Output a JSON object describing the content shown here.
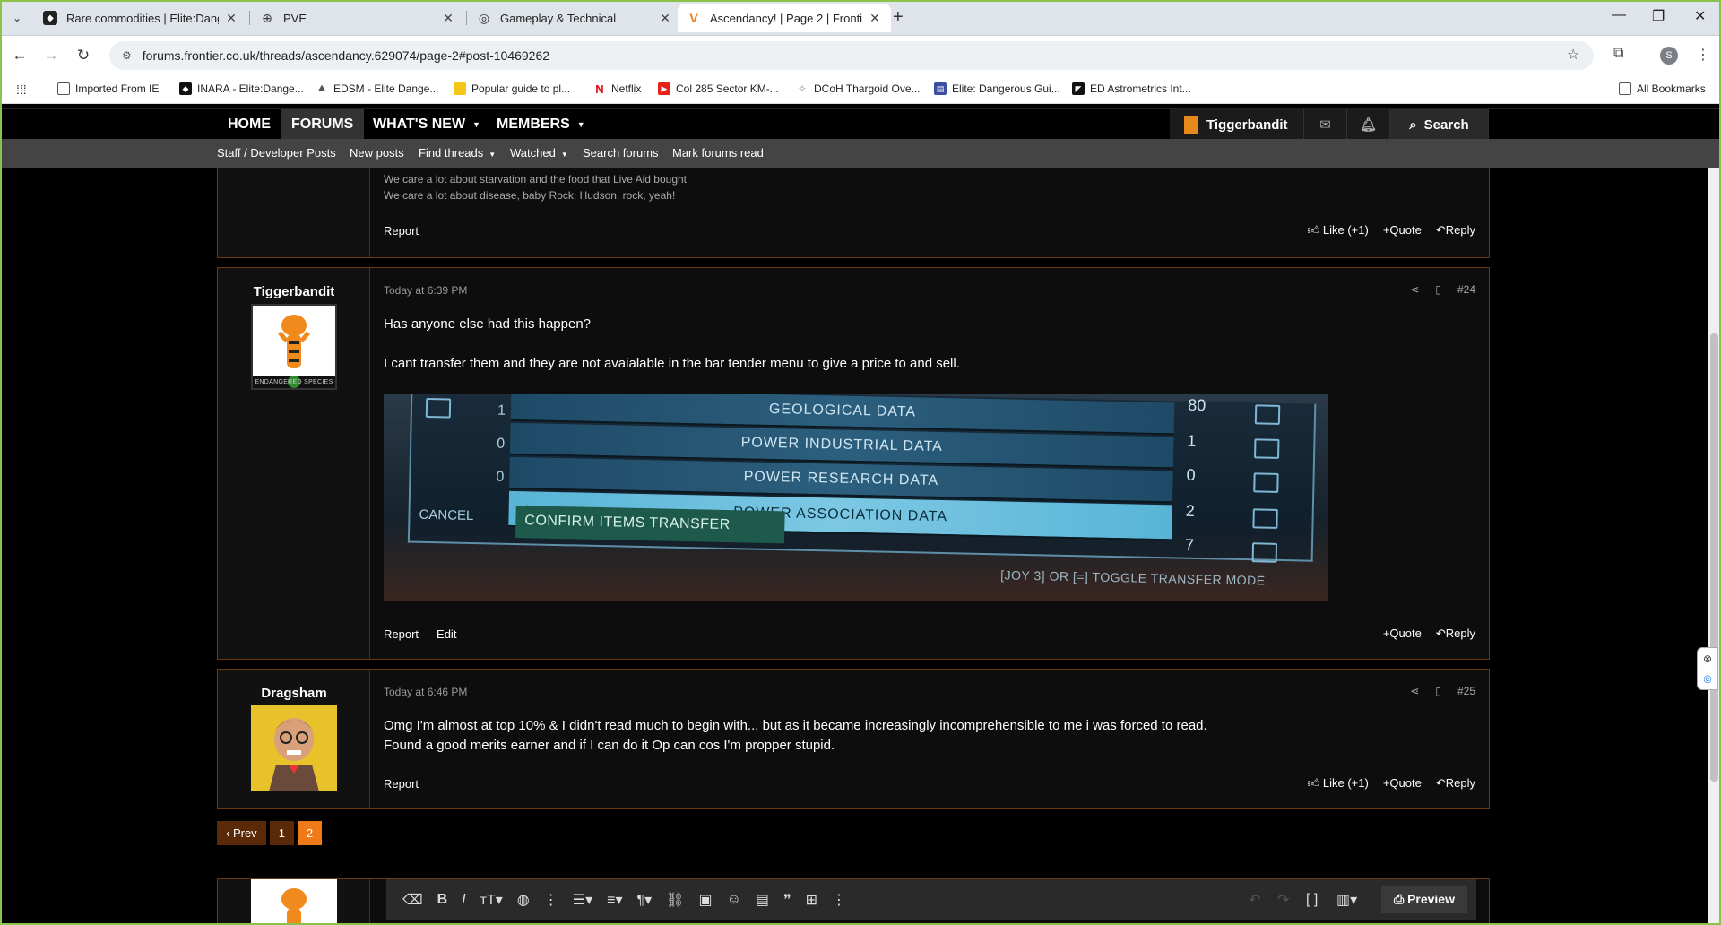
{
  "browser": {
    "tabs": [
      {
        "label": "Rare commodities | Elite:Dange",
        "active": false
      },
      {
        "label": "PVE",
        "active": false
      },
      {
        "label": "Gameplay & Technical",
        "active": false
      },
      {
        "label": "Ascendancy! | Page 2 | Frontier",
        "active": true
      }
    ],
    "url": "forums.frontier.co.uk/threads/ascendancy.629074/page-2#post-10469262",
    "bookmarks": [
      "Imported From IE",
      "INARA - Elite:Dange...",
      "EDSM - Elite Dange...",
      "Popular guide to pl...",
      "Netflix",
      "Col 285 Sector KM-...",
      "DCoH Thargoid Ove...",
      "Elite: Dangerous Gui...",
      "ED Astrometrics Int..."
    ],
    "all_bookmarks": "All Bookmarks",
    "profile_initial": "S"
  },
  "nav": {
    "home": "HOME",
    "forums": "FORUMS",
    "whats_new": "WHAT'S NEW",
    "members": "MEMBERS",
    "username": "Tiggerbandit",
    "search": "Search"
  },
  "subnav": [
    "Staff / Developer Posts",
    "New posts",
    "Find threads",
    "Watched",
    "Search forums",
    "Mark forums read"
  ],
  "post_prev": {
    "sig_lines": [
      "We care a lot about starvation and the food that Live Aid bought",
      "We care a lot about disease, baby Rock, Hudson, rock, yeah!"
    ],
    "report": "Report",
    "like": "Like (+1)",
    "quote": "Quote",
    "reply": "Reply"
  },
  "post24": {
    "username": "Tiggerbandit",
    "avatar_caption": "ENDANGERED SPECIES",
    "time": "Today at 6:39 PM",
    "number": "#24",
    "lines": [
      "Has anyone else had this happen?",
      "I cant transfer them and they are not avaialable in the bar tender menu to give a price to and sell."
    ],
    "screenshot": {
      "rows": [
        "GEOLOGICAL DATA",
        "POWER INDUSTRIAL DATA",
        "POWER RESEARCH DATA",
        "POWER ASSOCIATION DATA"
      ],
      "left_qty": [
        "1",
        "0",
        "0"
      ],
      "right_qty": [
        "80",
        "1",
        "0",
        "2",
        "7"
      ],
      "cancel": "CANCEL",
      "confirm": "CONFIRM ITEMS TRANSFER",
      "toggle": "[JOY 3] OR [=] TOGGLE TRANSFER MODE"
    },
    "report": "Report",
    "edit": "Edit",
    "quote": "Quote",
    "reply": "Reply"
  },
  "post25": {
    "username": "Dragsham",
    "time": "Today at 6:46 PM",
    "number": "#25",
    "lines": [
      "Omg I'm almost at top 10% & I didn't read much to begin with... but as it became increasingly incomprehensible to me i was forced to read.",
      "Found a good merits earner and if I can do it Op can cos I'm propper stupid."
    ],
    "report": "Report",
    "like": "Like (+1)",
    "quote": "Quote",
    "reply": "Reply"
  },
  "pagination": {
    "prev": "Prev",
    "pages": [
      "1",
      "2"
    ],
    "current": "2"
  },
  "editor": {
    "preview": "Preview"
  },
  "colors": {
    "accent": "#ef7a1a",
    "post_border": "#6b3a0c",
    "frame": "#8bc34a"
  }
}
